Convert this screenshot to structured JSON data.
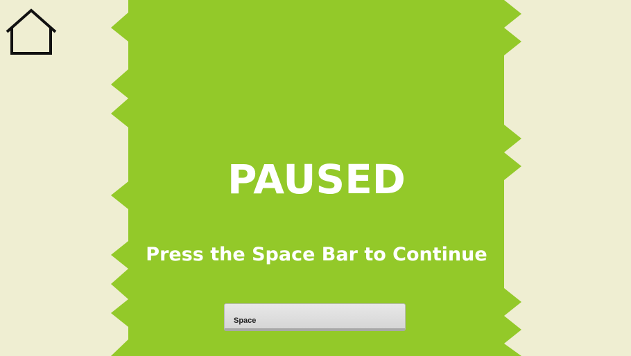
{
  "colors": {
    "background": "#efeed2",
    "playfield": "#93c929",
    "text": "#ffffff"
  },
  "home": {
    "icon": "home-icon"
  },
  "pause_screen": {
    "title": "PAUSED",
    "instruction": "Press the Space Bar to Continue"
  },
  "key": {
    "label": "Space"
  }
}
